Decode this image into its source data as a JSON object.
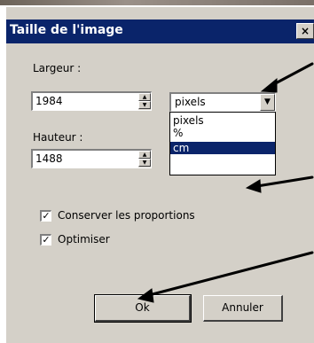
{
  "dialog": {
    "title": "Taille de l'image",
    "close_glyph": "×"
  },
  "width_field": {
    "label": "Largeur :",
    "value": "1984"
  },
  "height_field": {
    "label": "Hauteur :",
    "value": "1488"
  },
  "unit_dropdown": {
    "value": "pixels",
    "options": [
      "pixels",
      "%",
      "cm"
    ],
    "highlighted": "cm"
  },
  "checkboxes": [
    {
      "label": "Conserver les proportions",
      "checked": true
    },
    {
      "label": "Optimiser",
      "checked": true
    }
  ],
  "buttons": {
    "ok": "Ok",
    "cancel": "Annuler"
  },
  "colors": {
    "titlebar": "#0a246a",
    "dialog_face": "#d4d0c8",
    "highlight": "#0a246a"
  }
}
